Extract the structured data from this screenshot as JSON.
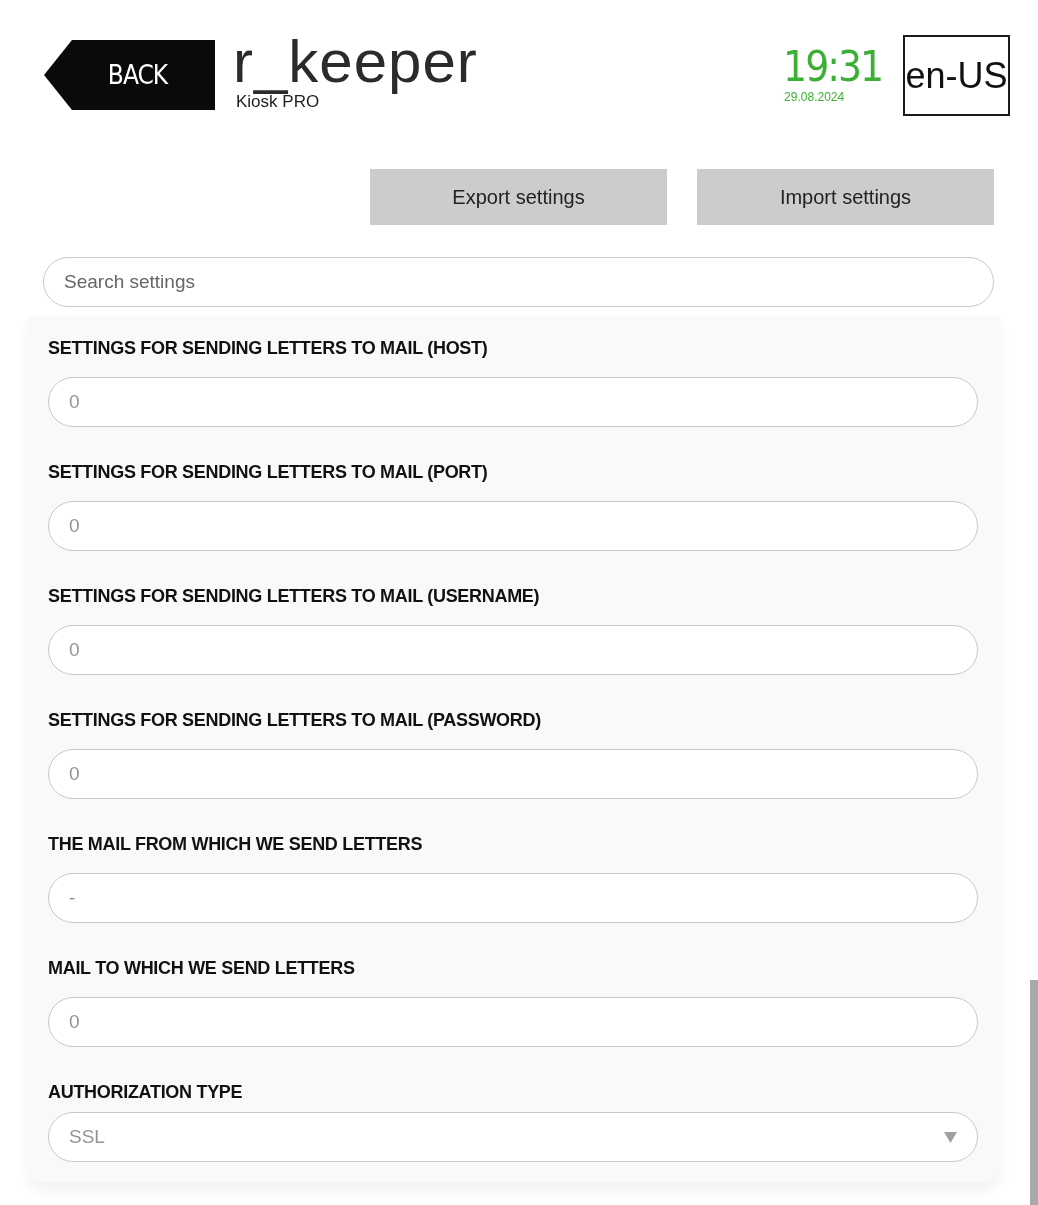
{
  "header": {
    "back_button": "BACK",
    "logo": "r_keeper",
    "subtitle": "Kiosk PRO",
    "time": "19:31",
    "date": "29.08.2024",
    "language": "en-US"
  },
  "actions": [
    "Export settings",
    "Import settings"
  ],
  "search": {
    "placeholder": "Search settings"
  },
  "settings": [
    {
      "kind": "text",
      "label": "SETTINGS FOR SENDING LETTERS TO MAIL (HOST)",
      "value": "0"
    },
    {
      "kind": "text",
      "label": "SETTINGS FOR SENDING LETTERS TO MAIL (PORT)",
      "value": "0"
    },
    {
      "kind": "text",
      "label": "SETTINGS FOR SENDING LETTERS TO MAIL (USERNAME)",
      "value": "0"
    },
    {
      "kind": "text",
      "label": "SETTINGS FOR SENDING LETTERS TO MAIL (PASSWORD)",
      "value": "0"
    },
    {
      "kind": "text",
      "label": "THE MAIL FROM WHICH WE SEND LETTERS",
      "value": "-"
    },
    {
      "kind": "text",
      "label": "MAIL TO WHICH WE SEND LETTERS",
      "value": "0"
    },
    {
      "kind": "select",
      "label": "AUTHORIZATION TYPE",
      "value": "SSL"
    }
  ]
}
